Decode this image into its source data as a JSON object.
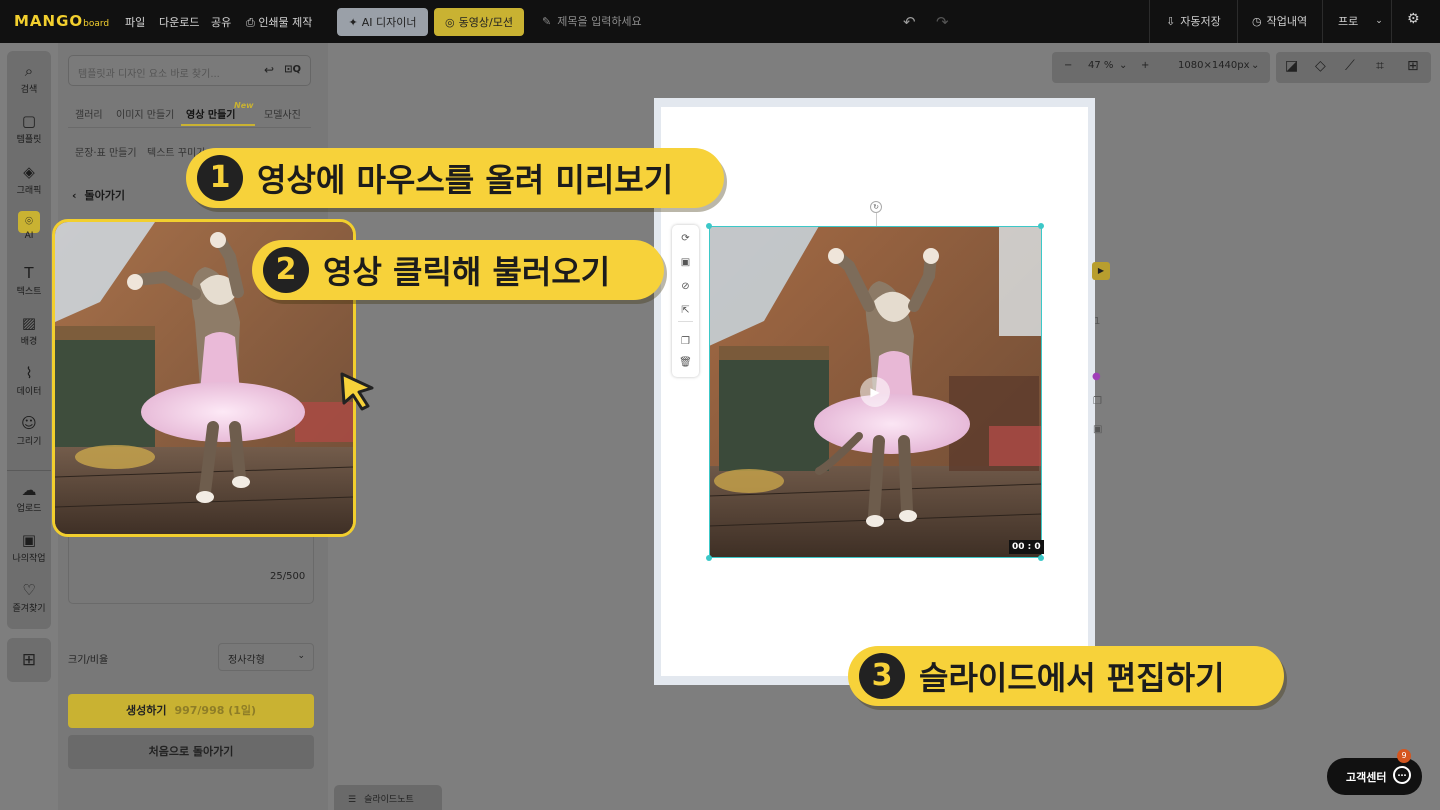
{
  "topbar": {
    "logo_main": "MANGO",
    "logo_sub": "board",
    "menu": [
      "파일",
      "다운로드",
      "공유"
    ],
    "print_label": "인쇄물 제작",
    "ai_designer_label": "AI 디자이너",
    "video_motion_label": "동영상/모션",
    "title_placeholder": "제목을 입력하세요",
    "autosave_label": "자동저장",
    "history_label": "작업내역",
    "plan_label": "프로"
  },
  "rail": {
    "items": [
      "검색",
      "템플릿",
      "그래픽",
      "AI",
      "텍스트",
      "배경",
      "데이터",
      "그리기",
      "업로드",
      "나의작업",
      "즐겨찾기"
    ]
  },
  "panel": {
    "search_placeholder": "템플릿과 디자인 요소 바로 찾기...",
    "tabs": [
      "갤러리",
      "이미지 만들기",
      "영상 만들기",
      "모델사진"
    ],
    "new_badge": "New",
    "tabs2": [
      "문장·표 만들기",
      "텍스트 꾸미기"
    ],
    "back_label": "돌아가기",
    "counter": "25/500",
    "size_label": "크기/비율",
    "size_value": "정사각형",
    "generate_label": "생성하기",
    "generate_sub": "997/998 (1일)",
    "reset_label": "처음으로 돌아가기"
  },
  "toolbar": {
    "zoom": "47 %",
    "dimensions": "1080×1440px"
  },
  "canvas": {
    "duration": "00 : 0"
  },
  "callouts": [
    {
      "num": "1",
      "text": "영상에 마우스를 올려 미리보기"
    },
    {
      "num": "2",
      "text": "영상 클릭해 불러오기"
    },
    {
      "num": "3",
      "text": "슬라이드에서 편집하기"
    }
  ],
  "footer": {
    "slide_note": "슬라이드노트",
    "customer_center": "고객센터",
    "badge_count": "9"
  },
  "colors": {
    "accent_yellow": "#f7d23a",
    "selection_cyan": "#3cc8c8",
    "topbar_bg": "#111111"
  }
}
